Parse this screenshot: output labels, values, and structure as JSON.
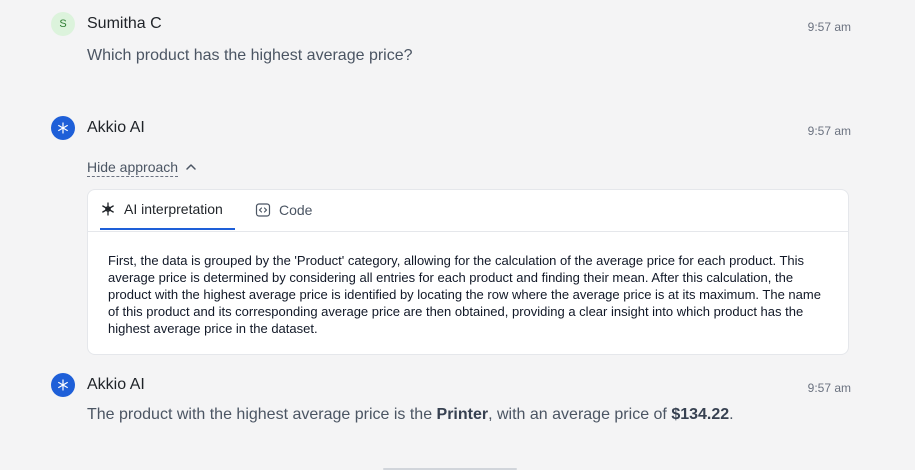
{
  "messages": [
    {
      "sender": "Sumitha C",
      "avatar_letter": "S",
      "time": "9:57 am",
      "text": "Which product has the highest average price?"
    },
    {
      "sender": "Akkio AI",
      "time": "9:57 am",
      "approach_toggle_label": "Hide approach",
      "tabs": [
        {
          "label": "AI interpretation",
          "icon": "sparkle-icon",
          "active": true
        },
        {
          "label": "Code",
          "icon": "code-icon",
          "active": false
        }
      ],
      "interpretation": "First, the data is grouped by the 'Product' category, allowing for the calculation of the average price for each product. This average price is determined by considering all entries for each product and finding their mean. After this calculation, the product with the highest average price is identified by locating the row where the average price is at its maximum. The name of this product and its corresponding average price are then obtained, providing a clear insight into which product has the highest average price in the dataset."
    },
    {
      "sender": "Akkio AI",
      "time": "9:57 am",
      "answer": {
        "prefix": "The product with the highest average price is the ",
        "product": "Printer",
        "middle": ", with an average price of ",
        "price": "$134.22",
        "suffix": "."
      }
    }
  ],
  "colors": {
    "background": "#f4f4f5",
    "accent": "#1e5fd8",
    "user_avatar_bg": "#dcf3dc"
  }
}
